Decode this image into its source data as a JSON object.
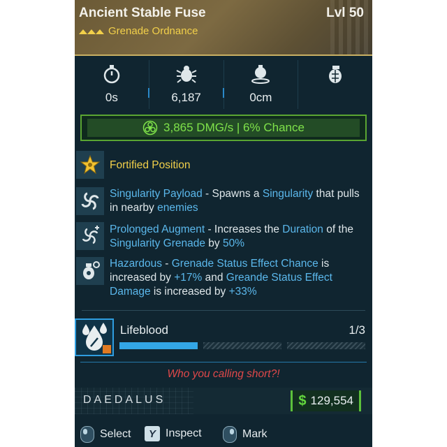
{
  "item": {
    "name": "Ancient Stable Fuse",
    "level": "Lvl 50",
    "type": "Grenade Ordnance",
    "rarity_color": "#f2d04a"
  },
  "stats": [
    {
      "icon": "stopwatch-icon",
      "value": "0s"
    },
    {
      "icon": "bug-enemy-icon",
      "value": "6,187"
    },
    {
      "icon": "grenade-radius-icon",
      "value": "0cm"
    },
    {
      "icon": "grenade-icon",
      "value": ""
    }
  ],
  "damage": {
    "icon": "biohazard-icon",
    "text": "3,865 DMG/s | 6% Chance",
    "color": "#7fe24a"
  },
  "perks": [
    {
      "icon": "star-medal-icon",
      "title": "Fortified Position"
    },
    {
      "icon": "singularity-icon",
      "name": "Singularity Payload",
      "t1": " - Spawns a ",
      "k1": "Singularity",
      "t2": " that pulls in nearby ",
      "k2": "enemies"
    },
    {
      "icon": "prolonged-singularity-icon",
      "name": "Prolonged Augment",
      "t1": " - Increases the ",
      "k1": "Duration",
      "t2": " of the ",
      "k2": "Singularity Grenade",
      "t3": " by ",
      "k3": "50%"
    },
    {
      "icon": "hazardous-grenade-icon",
      "name": "Hazardous",
      "t1": " - ",
      "k1": "Grenade Status Effect Chance",
      "t2": " is increased by ",
      "k2": "+17%",
      "t3": " and ",
      "k3": "Greande Status Effect Damage",
      "t4": " is increased by ",
      "k4": "+33%"
    }
  ],
  "mod": {
    "icon": "lifeblood-drops-icon",
    "name": "Lifeblood",
    "count": "1/3",
    "progress": [
      1,
      0,
      0
    ]
  },
  "flavor": "Who you calling short?!",
  "footer": {
    "brand": "DAEDALUS",
    "currency_symbol": "$",
    "price": "129,554",
    "price_color": "#63d83e"
  },
  "controls": [
    {
      "icon": "mouse-left-icon",
      "label": "Select"
    },
    {
      "key": "Y",
      "label": "Inspect"
    },
    {
      "icon": "mouse-right-icon",
      "label": "Mark"
    }
  ]
}
